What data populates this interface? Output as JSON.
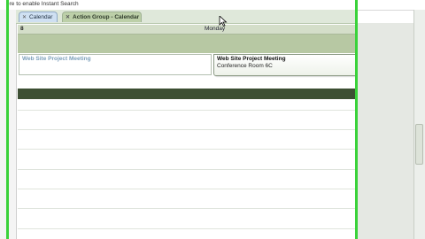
{
  "infobar": {
    "text": "ere to enable Instant Search"
  },
  "tabs": [
    {
      "label": "Calendar",
      "close_icon": "x-icon"
    },
    {
      "label": "Action Group - Calendar",
      "close_icon": "x-icon"
    }
  ],
  "day_header": {
    "date_number": "8",
    "day_name": "Monday"
  },
  "appointments": [
    {
      "title": "Web Site Project Meeting"
    },
    {
      "title": "Web Site Project Meeting",
      "location": "Conference Room 6C"
    }
  ],
  "colors": {
    "highlight_bar": "#3ad23a",
    "allday_band": "#b7c8a3",
    "divider": "#3d4f33"
  }
}
